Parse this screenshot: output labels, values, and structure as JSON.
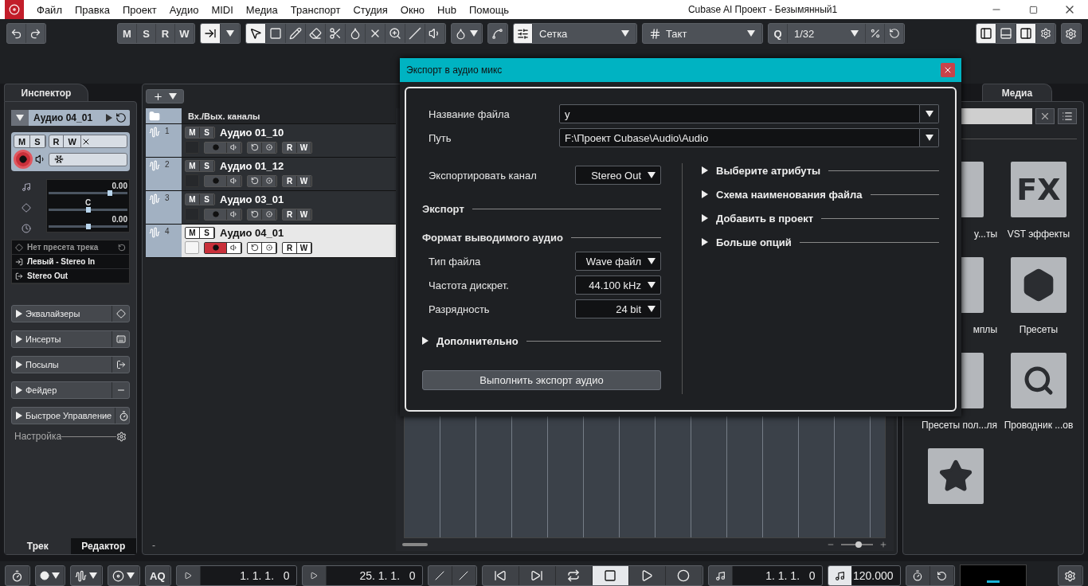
{
  "menu_bar": {
    "items": [
      "Файл",
      "Правка",
      "Проект",
      "Аудио",
      "MIDI",
      "Медиа",
      "Транспорт",
      "Студия",
      "Окно",
      "Hub",
      "Помощь"
    ],
    "title": "Cubase AI Проект - Безымянный1"
  },
  "toolbar": {
    "mode_buttons": [
      "M",
      "S",
      "R",
      "W"
    ],
    "tools": [
      {
        "kind": "pointer",
        "selected": true
      },
      {
        "kind": "range",
        "selected": false
      },
      {
        "kind": "pencil",
        "selected": false
      },
      {
        "kind": "eraser",
        "selected": false
      },
      {
        "kind": "scissors",
        "selected": false
      },
      {
        "kind": "glue",
        "selected": false
      },
      {
        "kind": "mute",
        "selected": false
      },
      {
        "kind": "zoom",
        "selected": false
      },
      {
        "kind": "line",
        "selected": false
      },
      {
        "kind": "play",
        "selected": false
      }
    ],
    "snap_mode": "Сетка",
    "grid_type": "Такт",
    "quantize_label": "Q",
    "quantize": "1/32",
    "zones": [
      {
        "kind": "left",
        "selected": true
      },
      {
        "kind": "lower",
        "selected": false
      },
      {
        "kind": "right",
        "selected": true
      }
    ]
  },
  "inspector": {
    "tab": "Инспектор",
    "track_name": "Аудио 04_01",
    "buttons": [
      "M",
      "S",
      "R",
      "W"
    ],
    "record_enabled": true,
    "volume": {
      "reading": "0.00",
      "level": 0.78
    },
    "pan": {
      "reading": "C",
      "level": 0.5
    },
    "delay": {
      "reading": "0.00",
      "level": 0.5
    },
    "preset": "Нет пресета трека",
    "input": "Левый - Stereo In",
    "output": "Stereo Out",
    "sections": [
      {
        "label": "Эквалайзеры",
        "expanded": false
      },
      {
        "label": "Инсерты",
        "expanded": false
      },
      {
        "label": "Посылы",
        "expanded": false
      },
      {
        "label": "Фейдер",
        "expanded": false
      },
      {
        "label": "Быстрое Управление",
        "expanded": false
      }
    ],
    "settings": "Настройка",
    "bottom_tabs": [
      {
        "label": "Трек",
        "selected": true
      },
      {
        "label": "Редактор",
        "selected": false
      }
    ]
  },
  "project": {
    "header": "Вх./Вых. каналы",
    "tracks": [
      {
        "number": "1",
        "name": "Аудио 01_10",
        "selected": false,
        "record_enabled": false,
        "mute": "M",
        "solo": "S",
        "read": "R",
        "write": "W"
      },
      {
        "number": "2",
        "name": "Аудио 01_12",
        "selected": false,
        "record_enabled": false,
        "mute": "M",
        "solo": "S",
        "read": "R",
        "write": "W"
      },
      {
        "number": "3",
        "name": "Аудио 03_01",
        "selected": false,
        "record_enabled": false,
        "mute": "M",
        "solo": "S",
        "read": "R",
        "write": "W"
      },
      {
        "number": "4",
        "name": "Аудио 04_01",
        "selected": true,
        "record_enabled": true,
        "mute": "M",
        "solo": "S",
        "read": "R",
        "write": "W"
      }
    ],
    "footer": "-",
    "zoom_slider": {
      "level": 0.55
    }
  },
  "media": {
    "tab": "Медиа",
    "tiles": [
      {
        "kind": "hidden",
        "label": "у...ты"
      },
      {
        "kind": "fx",
        "glyph": "FX",
        "label": "VST эффекты"
      },
      {
        "kind": "hidden",
        "label": "мплы"
      },
      {
        "kind": "presets",
        "label": "Пресеты"
      },
      {
        "kind": "hidden",
        "label": "Пресеты пол...ля"
      },
      {
        "kind": "browser",
        "label": "Проводник ...ов"
      },
      {
        "kind": "favorites"
      }
    ]
  },
  "dialog": {
    "title": "Экспорт в аудио микс",
    "file_name": {
      "label": "Название файла",
      "value": "y"
    },
    "path": {
      "label": "Путь",
      "value": "F:\\Проект Cubase\\Audio\\Audio"
    },
    "channel": {
      "label": "Экспортировать канал",
      "value": "Stereo Out"
    },
    "export_heading": "Экспорт",
    "format_heading": "Формат выводимого аудио",
    "format_rows": [
      {
        "label": "Тип файла",
        "value": "Wave файл"
      },
      {
        "label": "Частота дискрет.",
        "value": "44.100 kHz"
      },
      {
        "label": "Разрядность",
        "value": "24 bit"
      }
    ],
    "advanced": {
      "label": "Дополнительно",
      "expanded": false
    },
    "export_button": "Выполнить экспорт аудио",
    "options": [
      {
        "label": "Выберите атрибуты",
        "expanded": false
      },
      {
        "label": "Схема наименования файла",
        "expanded": false
      },
      {
        "label": "Добавить в проект",
        "expanded": false
      },
      {
        "label": "Больше опций",
        "expanded": false
      }
    ]
  },
  "transport": {
    "aq": "AQ",
    "left_locator": "1. 1. 1.   0",
    "right_locator": "25. 1. 1.   0",
    "buttons": [
      {
        "kind": "to-start",
        "selected": false
      },
      {
        "kind": "to-end",
        "selected": false
      },
      {
        "kind": "cycle",
        "selected": false
      },
      {
        "kind": "stop",
        "selected": true
      },
      {
        "kind": "play",
        "selected": false
      },
      {
        "kind": "record",
        "selected": false
      }
    ],
    "position": "1. 1. 1.   0",
    "tempo": "120.000"
  }
}
